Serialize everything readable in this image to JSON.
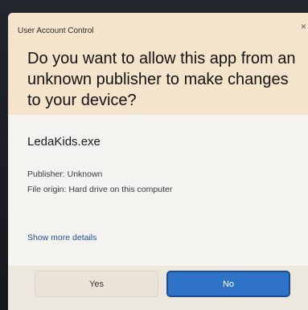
{
  "dialog": {
    "title": "User Account Control",
    "close_glyph": "×",
    "question": "Do you want to allow this app from an unknown publisher to make changes to your device?",
    "app_name": "LedaKids.exe",
    "publisher": "Publisher: Unknown",
    "file_origin": "File origin: Hard drive on this computer",
    "details_link": "Show more details",
    "buttons": {
      "yes": "Yes",
      "no": "No"
    }
  },
  "colors": {
    "header_background": "#f3e4cb",
    "body_background": "#f4f3f0",
    "accent_button": "#2f73c8",
    "link": "#1d4e8f"
  }
}
